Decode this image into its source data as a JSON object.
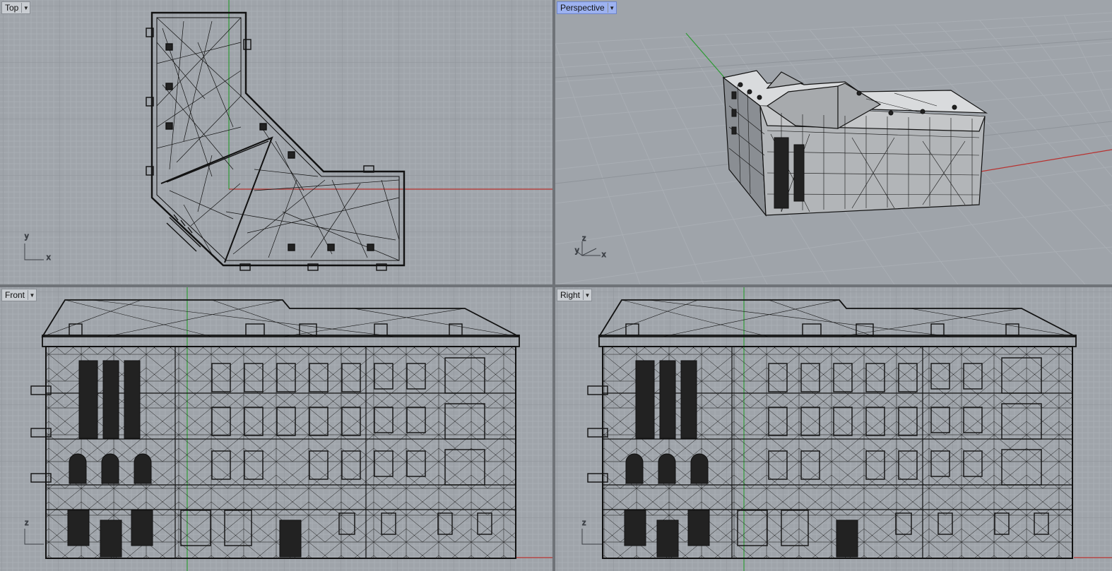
{
  "viewports": [
    {
      "id": "top",
      "name": "Top",
      "active": false,
      "axes": [
        "y",
        "x"
      ]
    },
    {
      "id": "perspective",
      "name": "Perspective",
      "active": true,
      "axes": [
        "z",
        "y",
        "x"
      ]
    },
    {
      "id": "front",
      "name": "Front",
      "active": false,
      "axes": [
        "z"
      ]
    },
    {
      "id": "right",
      "name": "Right",
      "active": false,
      "axes": [
        "z"
      ]
    }
  ],
  "colors": {
    "background": "#9fa4aa",
    "grid_minor": "#a8adb3",
    "grid_major": "#8f949a",
    "x_axis": "#b8312f",
    "y_axis": "#2e9a35",
    "wire": "#111111",
    "active_tab": "#9db2f0"
  },
  "icons": {
    "dropdown": "chevron-down-icon",
    "axis": "axis-triad-icon"
  }
}
